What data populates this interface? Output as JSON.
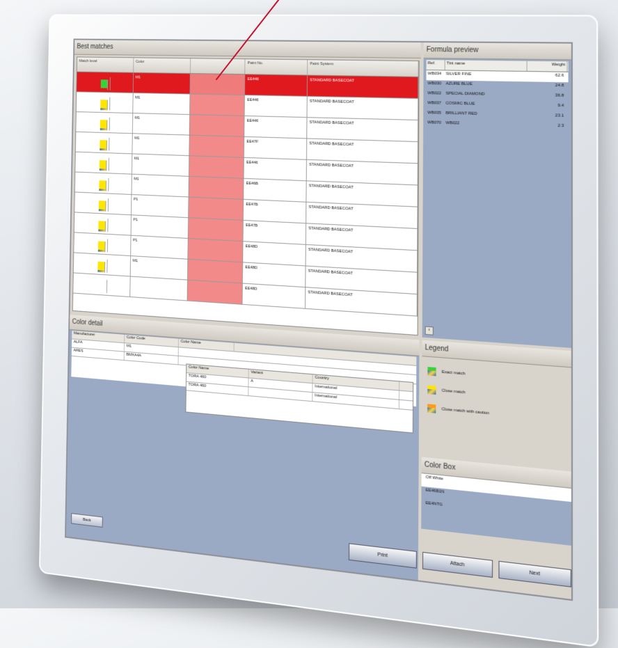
{
  "best_matches": {
    "title": "Best matches",
    "columns": [
      "Match level",
      "Color",
      "",
      "Paint No.",
      "Paint System"
    ],
    "rows": [
      {
        "match": "exact",
        "color": "M1",
        "no": "EE446",
        "system": "STANDARD BASECOAT",
        "selected": true
      },
      {
        "match": "close",
        "color": "M1",
        "no": "EE446",
        "system": "STANDARD BASECOAT",
        "selected": false
      },
      {
        "match": "close",
        "color": "M1",
        "no": "EE446",
        "system": "STANDARD BASECOAT",
        "selected": false
      },
      {
        "match": "close",
        "color": "M1",
        "no": "EE47F",
        "system": "STANDARD BASECOAT",
        "selected": false
      },
      {
        "match": "close",
        "color": "M1",
        "no": "EE446",
        "system": "STANDARD BASECOAT",
        "selected": false
      },
      {
        "match": "close",
        "color": "M1",
        "no": "EE46B",
        "system": "STANDARD BASECOAT",
        "selected": false
      },
      {
        "match": "close",
        "color": "P1",
        "no": "EE47B",
        "system": "STANDARD BASECOAT",
        "selected": false
      },
      {
        "match": "close",
        "color": "P1",
        "no": "EE47B",
        "system": "STANDARD BASECOAT",
        "selected": false
      },
      {
        "match": "close",
        "color": "P1",
        "no": "EE48D",
        "system": "STANDARD BASECOAT",
        "selected": false
      },
      {
        "match": "close",
        "color": "M1",
        "no": "EE48D",
        "system": "STANDARD BASECOAT",
        "selected": false
      },
      {
        "match": "none",
        "color": "",
        "no": "EE48D",
        "system": "STANDARD BASECOAT",
        "selected": false
      }
    ]
  },
  "formula_preview": {
    "title": "Formula preview",
    "columns": [
      "Ref.",
      "Tint name",
      "Weight"
    ],
    "rows": [
      {
        "ref": "WB034",
        "name": "SILVER FINE",
        "w": "62.6",
        "selected": true
      },
      {
        "ref": "WB030",
        "name": "AZURE BLUE",
        "w": "24.8",
        "selected": false
      },
      {
        "ref": "WB022",
        "name": "SPECIAL DIAMOND",
        "w": "36.8",
        "selected": false
      },
      {
        "ref": "WB037",
        "name": "COSMIC BLUE",
        "w": "9.4",
        "selected": false
      },
      {
        "ref": "WB035",
        "name": "BRILLIANT RED",
        "w": "23.1",
        "selected": false
      },
      {
        "ref": "WB070",
        "name": "WB022",
        "w": "2.3",
        "selected": false
      }
    ]
  },
  "color_detail": {
    "title": "Color detail",
    "columns": [
      "Manufacturer",
      "Color Code",
      "Color Name"
    ],
    "rows": [
      [
        "ALFA",
        "M1",
        ""
      ],
      [
        "ARES",
        "BMXA4A",
        ""
      ]
    ],
    "sub_columns": [
      "Color Name",
      "Variant",
      "Country"
    ],
    "sub_rows": [
      [
        "TORA 460",
        "A",
        "International"
      ],
      [
        "TORA 460",
        "",
        "International"
      ]
    ],
    "back_label": "Back"
  },
  "legend": {
    "title": "Legend",
    "items": [
      {
        "label": "Exact match",
        "kind": "exact"
      },
      {
        "label": "Close match",
        "kind": "close"
      },
      {
        "label": "Close match with caution",
        "kind": "caution"
      }
    ]
  },
  "color_box": {
    "title": "Color Box",
    "rows": [
      {
        "text": "Off White",
        "selected": true
      },
      {
        "text": "EE46B1N",
        "selected": false
      },
      {
        "text": "EE4NTG",
        "selected": false
      }
    ]
  },
  "buttons": {
    "print": "Print",
    "attach": "Attach",
    "next": "Next"
  },
  "colors": {
    "selected_row": "#e0191f",
    "highlight": "#f28a8a",
    "panel_blue": "#9aa9c4",
    "pointer": "#c4122f"
  }
}
